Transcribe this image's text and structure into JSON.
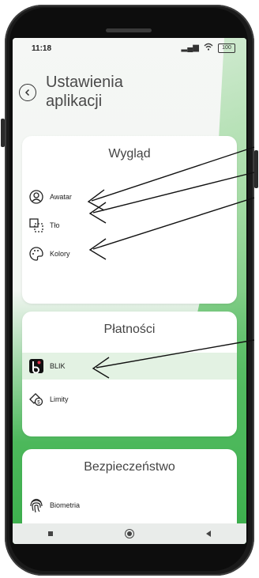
{
  "status": {
    "time": "11:18",
    "battery": "100"
  },
  "header": {
    "title": "Ustawienia\naplikacji"
  },
  "sections": {
    "appearance": {
      "title": "Wygląd",
      "items": [
        {
          "label": "Awatar",
          "icon": "avatar-icon"
        },
        {
          "label": "Tło",
          "icon": "background-icon"
        },
        {
          "label": "Kolory",
          "icon": "palette-icon"
        }
      ]
    },
    "payments": {
      "title": "Płatności",
      "items": [
        {
          "label": "BLIK",
          "icon": "blik-icon"
        },
        {
          "label": "Limity",
          "icon": "limits-icon"
        }
      ]
    },
    "security": {
      "title": "Bezpieczeństwo",
      "items": [
        {
          "label": "Biometria",
          "icon": "fingerprint-icon"
        }
      ]
    }
  },
  "colors": {
    "accent_green": "#3cae4e",
    "highlight": "#e3f2e3"
  }
}
